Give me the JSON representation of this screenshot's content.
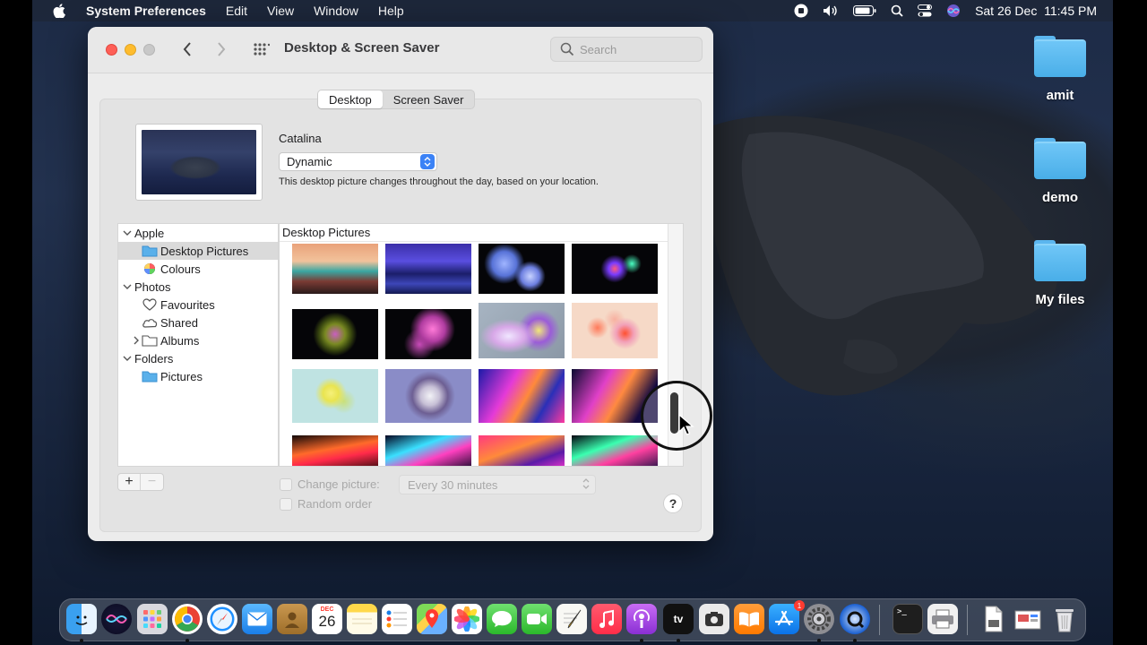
{
  "menubar": {
    "app_name": "System Preferences",
    "menus": [
      "Edit",
      "View",
      "Window",
      "Help"
    ],
    "datetime": "Sat 26 Dec  11:45 PM"
  },
  "window": {
    "title": "Desktop & Screen Saver",
    "search_placeholder": "Search",
    "tabs": [
      "Desktop",
      "Screen Saver"
    ],
    "active_tab": "Desktop",
    "picture_name": "Catalina",
    "picture_mode": "Dynamic",
    "description": "This desktop picture changes throughout the day, based on your location.",
    "sidebar": [
      {
        "label": "Apple",
        "type": "group",
        "expanded": true
      },
      {
        "label": "Desktop Pictures",
        "type": "item",
        "icon": "folder-icon",
        "selected": true
      },
      {
        "label": "Colours",
        "type": "item",
        "icon": "color-wheel-icon"
      },
      {
        "label": "Photos",
        "type": "group",
        "expanded": true
      },
      {
        "label": "Favourites",
        "type": "item",
        "icon": "heart-icon"
      },
      {
        "label": "Shared",
        "type": "item",
        "icon": "cloud-icon"
      },
      {
        "label": "Albums",
        "type": "item",
        "icon": "folder-icon",
        "collapsed": true
      },
      {
        "label": "Folders",
        "type": "group",
        "expanded": true
      },
      {
        "label": "Pictures",
        "type": "item",
        "icon": "folder-icon"
      }
    ],
    "grid_header": "Desktop Pictures",
    "change_picture_label": "Change picture:",
    "interval": "Every 30 minutes",
    "random_order_label": "Random order",
    "help_label": "?"
  },
  "desktop_icons": [
    "amit",
    "demo",
    "My files"
  ],
  "dock": {
    "calendar_month": "DEC",
    "calendar_day": "26",
    "appstore_badge": "1",
    "tv_label": "tv"
  }
}
